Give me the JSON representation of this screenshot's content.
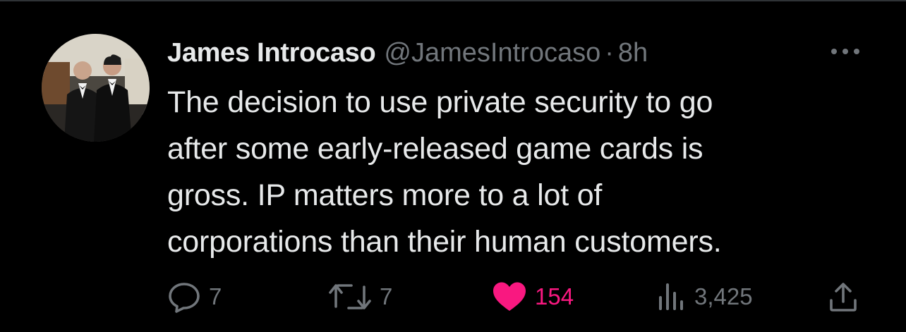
{
  "author": {
    "name": "James Introcaso",
    "handle": "@JamesIntrocaso",
    "separator": "·",
    "time": "8h"
  },
  "tweet": {
    "lines": [
      "The decision to use private security to go",
      "after some early-released game cards is",
      "gross. IP matters more to a lot of",
      "corporations than their human customers."
    ]
  },
  "actions": {
    "replies": "7",
    "retweets": "7",
    "likes": "154",
    "views": "3,425"
  },
  "colors": {
    "background": "#000000",
    "text": "#e7e9ea",
    "secondary": "#71767b",
    "like": "#f91880"
  },
  "icons": [
    "more-icon",
    "reply-icon",
    "retweet-icon",
    "heart-icon",
    "views-icon",
    "share-icon"
  ]
}
